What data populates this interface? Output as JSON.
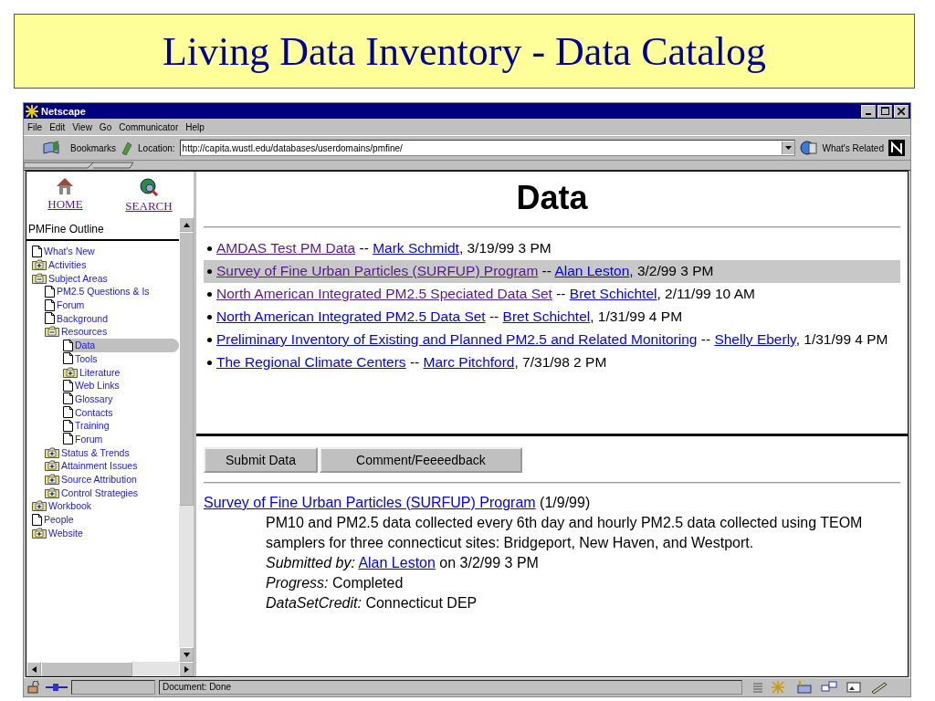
{
  "slide": {
    "title": "Living Data Inventory - Data Catalog"
  },
  "window": {
    "title": "Netscape"
  },
  "menu": [
    "File",
    "Edit",
    "View",
    "Go",
    "Communicator",
    "Help"
  ],
  "toolbar": {
    "bookmarks": "Bookmarks",
    "location_label": "Location:",
    "location": "http://capita.wustl.edu/databases/userdomains/pmfine/",
    "whats_related": "What's Related"
  },
  "sidebar": {
    "home": "HOME",
    "search": "SEARCH",
    "outline_title": "PMFine Outline",
    "tree": [
      {
        "kind": "page",
        "label": "What's New",
        "selected": false
      },
      {
        "kind": "folder",
        "label": "Activities",
        "expanded": false,
        "selected": false
      },
      {
        "kind": "folder",
        "label": "Subject Areas",
        "expanded": true,
        "selected": false,
        "children": [
          {
            "kind": "page",
            "label": "PM2.5 Questions & Is",
            "selected": false
          },
          {
            "kind": "page",
            "label": "Forum",
            "selected": false
          },
          {
            "kind": "page",
            "label": "Background",
            "selected": false
          },
          {
            "kind": "folder",
            "label": "Resources",
            "expanded": true,
            "selected": false,
            "children": [
              {
                "kind": "page",
                "label": "Data",
                "selected": true
              },
              {
                "kind": "page",
                "label": "Tools",
                "selected": false
              },
              {
                "kind": "folder",
                "label": "Literature",
                "expanded": false,
                "selected": false
              },
              {
                "kind": "page",
                "label": "Web Links",
                "selected": false
              },
              {
                "kind": "page",
                "label": "Glossary",
                "selected": false
              },
              {
                "kind": "page",
                "label": "Contacts",
                "selected": false
              },
              {
                "kind": "page",
                "label": "Training",
                "selected": false
              },
              {
                "kind": "page",
                "label": "Forum",
                "selected": false
              }
            ]
          },
          {
            "kind": "folder",
            "label": "Status & Trends",
            "expanded": false,
            "selected": false
          },
          {
            "kind": "folder",
            "label": "Attainment Issues",
            "expanded": false,
            "selected": false
          },
          {
            "kind": "folder",
            "label": "Source Attribution",
            "expanded": false,
            "selected": false
          },
          {
            "kind": "folder",
            "label": "Control Strategies",
            "expanded": false,
            "selected": false
          }
        ]
      },
      {
        "kind": "folder",
        "label": "Workbook",
        "expanded": false,
        "selected": false
      },
      {
        "kind": "page",
        "label": "People",
        "selected": false
      },
      {
        "kind": "folder",
        "label": "Website",
        "expanded": false,
        "selected": false
      }
    ]
  },
  "page": {
    "heading": "Data",
    "entries": [
      {
        "title": "AMDAS Test PM Data",
        "visited": true,
        "author": "Mark Schmidt",
        "date": ", 3/19/99 3 PM",
        "selected": false
      },
      {
        "title": "Survey of Fine Urban Particles (SURFUP) Program",
        "visited": true,
        "author": "Alan Leston",
        "date": ", 3/2/99 3 PM",
        "selected": true
      },
      {
        "title": "North American Integrated PM2.5 Speciated Data Set",
        "visited": true,
        "author": "Bret Schichtel",
        "date": ", 2/11/99 10 AM",
        "selected": false
      },
      {
        "title": "North American Integrated PM2.5 Data Set",
        "visited": false,
        "author": "Bret Schichtel",
        "date": ", 1/31/99 4 PM",
        "selected": false
      },
      {
        "title": "Preliminary Inventory of Existing and Planned PM2.5 and Related Monitoring",
        "visited": false,
        "author": "Shelly Eberly",
        "date": ", 1/31/99 4 PM",
        "selected": false
      },
      {
        "title": "The Regional Climate Centers",
        "visited": false,
        "author": "Marc Pitchford",
        "date": ", 7/31/98 2 PM",
        "selected": false
      }
    ],
    "separator": "--"
  },
  "detail": {
    "buttons": [
      "Submit Data",
      "Comment/Feeeedback"
    ],
    "title": "Survey of Fine Urban Particles (SURFUP) Program",
    "title_date": "(1/9/99)",
    "description": "PM10 and PM2.5 data collected every 6th day and hourly PM2.5 data collected using TEOM samplers for three connecticut sites: Bridgeport, New Haven, and Westport.",
    "fields": [
      {
        "label": "Submitted by:",
        "link": "Alan Leston",
        "value": "on 3/2/99 3 PM"
      },
      {
        "label": "Progress:",
        "value": "Completed"
      },
      {
        "label": "DataSetCredit:",
        "value": "Connecticut DEP"
      }
    ]
  },
  "status_bar": {
    "text": "Document: Done"
  }
}
